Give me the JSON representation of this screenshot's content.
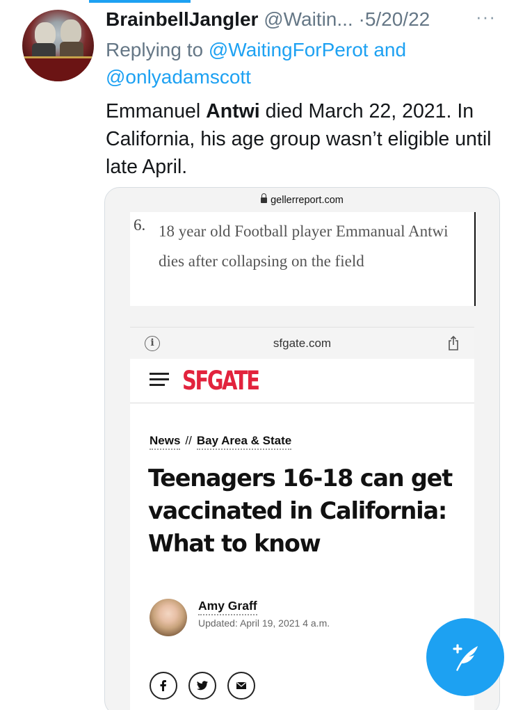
{
  "tweet": {
    "display_name": "BrainbellJangler",
    "handle": "@Waitin...",
    "dot": "·",
    "date": "5/20/22",
    "more_icon": "more-icon",
    "replying_to_label": "Replying to",
    "reply_mention_1": "@WaitingForPerot",
    "reply_and": "and",
    "reply_mention_2": "@onlyadamscott",
    "text_before": "Emmanuel ",
    "text_bold": "Antwi",
    "text_after": " died March 22, 2021. In California, his age group wasn’t eligible until late April."
  },
  "media": {
    "geller_domain": "gellerreport.com",
    "geller_item_number": "6.",
    "geller_item_text": "18 year old Football player Emmanual Antwi dies after collapsing on the field",
    "sf_domain": "sfgate.com",
    "sf_logo": "SFGATE",
    "breadcrumb_news": "News",
    "breadcrumb_sep": "//",
    "breadcrumb_section": "Bay Area & State",
    "headline": "Teenagers 16-18 can get vaccinated in California: What to know",
    "author_name": "Amy Graff",
    "updated": "Updated: April 19, 2021 4 a.m."
  },
  "colors": {
    "accent": "#1da1f2",
    "muted": "#657786",
    "sfgate_red": "#e2233d"
  },
  "fab_icon": "compose-tweet-icon"
}
